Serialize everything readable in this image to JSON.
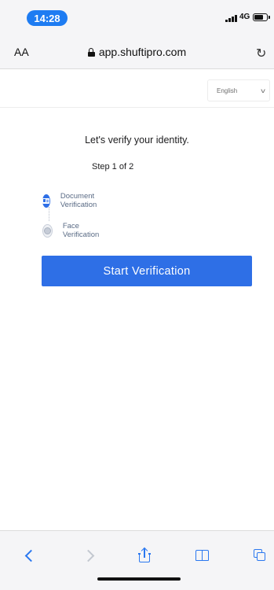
{
  "status_bar": {
    "time": "14:28",
    "network": "4G"
  },
  "address_bar": {
    "text_size_label": "AA",
    "url": "app.shuftipro.com"
  },
  "language_select": {
    "selected": "English"
  },
  "main": {
    "heading": "Let's verify your identity.",
    "step_indicator": "Step 1 of 2",
    "steps": [
      {
        "label": "Document Verification",
        "icon": "id-card-icon",
        "state": "active"
      },
      {
        "label": "Face Verification",
        "icon": "face-icon",
        "state": "pending"
      }
    ],
    "start_button_label": "Start Verification"
  },
  "toolbar": {
    "buttons": [
      "back-icon",
      "forward-icon",
      "share-icon",
      "bookmarks-icon",
      "tabs-icon"
    ]
  },
  "colors": {
    "accent": "#2e6fe6",
    "time_pill": "#1e7cf2",
    "toolbar_icon": "#2b78f0"
  }
}
